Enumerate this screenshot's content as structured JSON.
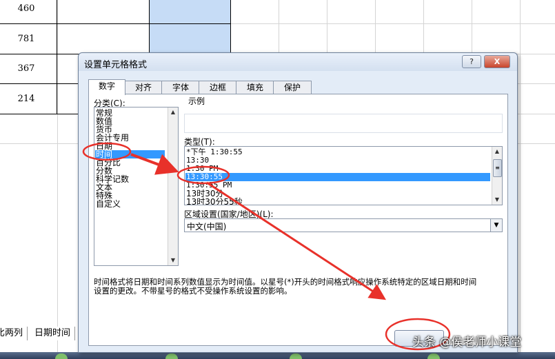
{
  "spreadsheet": {
    "cells": [
      "460",
      "781",
      "367",
      "214"
    ],
    "sheet_tabs": [
      "比两列",
      "日期时间"
    ]
  },
  "dialog": {
    "title": "设置单元格格式",
    "help_label": "?",
    "close_label": "X",
    "tabs": [
      "数字",
      "对齐",
      "字体",
      "边框",
      "填充",
      "保护"
    ],
    "category_label": "分类(C):",
    "categories": [
      "常规",
      "数值",
      "货币",
      "会计专用",
      "日期",
      "时间",
      "百分比",
      "分数",
      "科学记数",
      "文本",
      "特殊",
      "自定义"
    ],
    "selected_category": "时间",
    "sample_label": "示例",
    "type_label": "类型(T):",
    "types": [
      "*下午 1:30:55",
      "13:30",
      "1:30 PM",
      "13:30:55",
      "1:30:55 PM",
      "13时30分",
      "13时30分55秒"
    ],
    "selected_type": "13:30:55",
    "locale_label": "区域设置(国家/地区)(L):",
    "locale_value": "中文(中国)",
    "description_line1": "时间格式将日期和时间系列数值显示为时间值。以星号(*)开头的时间格式响应操作系统特定的区域日期和时间",
    "description_line2": "设置的更改。不带星号的格式不受操作系统设置的影响。",
    "ok_label": ""
  },
  "annotation_color": "#e8312a",
  "watermark": "头条 @侯老师小课堂"
}
